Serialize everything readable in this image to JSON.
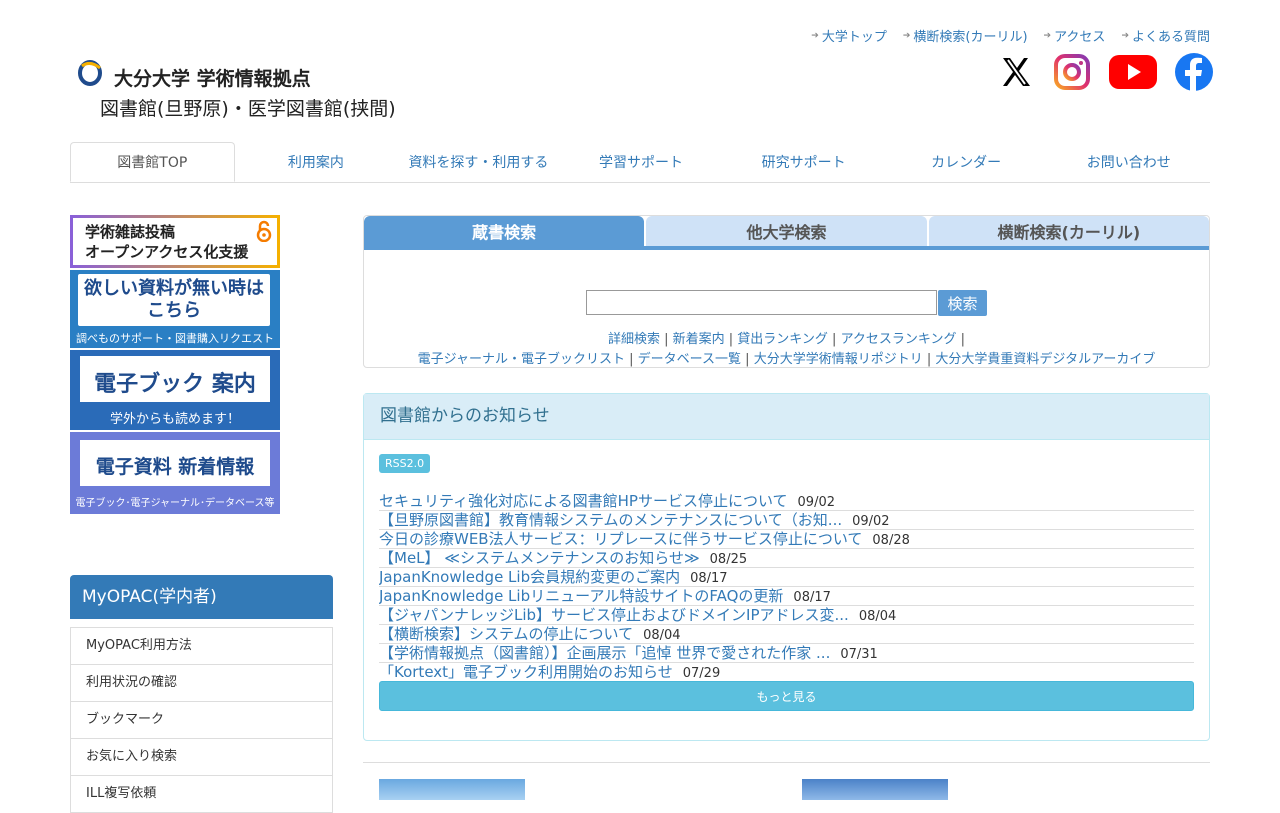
{
  "header": {
    "toplinks": [
      "大学トップ",
      "横断検索(カーリル)",
      "アクセス",
      "よくある質問"
    ],
    "logo_line1": "大分大学 学術情報拠点",
    "logo_line2": "図書館(旦野原)・医学図書館(挟間)",
    "social": [
      "x-icon",
      "instagram-icon",
      "youtube-icon",
      "facebook-icon"
    ]
  },
  "nav": {
    "tabs": [
      "図書館TOP",
      "利用案内",
      "資料を探す・利用する",
      "学習サポート",
      "研究サポート",
      "カレンダー",
      "お問い合わせ"
    ]
  },
  "banners": {
    "oa_line1": "学術雑誌投稿",
    "oa_line2": "オープンアクセス化支援",
    "request_line1": "欲しい資料が無い時は",
    "request_line2": "こちら",
    "request_sub": "調べものサポート・図書購入リクエスト",
    "ebook_title": "電子ブック 案内",
    "ebook_sub": "学外からも読めます！",
    "eres_title": "電子資料 新着情報",
    "eres_sub": "電子ブック･電子ジャーナル･データベース等"
  },
  "myopac": {
    "title": "MyOPAC(学内者)",
    "items": [
      "MyOPAC利用方法",
      "利用状況の確認",
      "ブックマーク",
      "お気に入り検索",
      "ILL複写依頼"
    ]
  },
  "search": {
    "tabs": [
      "蔵書検索",
      "他大学検索",
      "横断検索(カーリル)"
    ],
    "button": "検索",
    "input_value": "",
    "links_row1": [
      "詳細検索",
      "新着案内",
      "貸出ランキング",
      "アクセスランキング"
    ],
    "links_row2": [
      "電子ジャーナル・電子ブックリスト",
      "データベース一覧",
      "大分大学学術情報リポジトリ",
      "大分大学貴重資料デジタルアーカイブ"
    ]
  },
  "news": {
    "title": "図書館からのお知らせ",
    "rss": "RSS2.0",
    "items": [
      {
        "title": "セキュリティ強化対応による図書館HPサービス停止について",
        "date": "09/02"
      },
      {
        "title": "【旦野原図書館】教育情報システムのメンテナンスについて（お知...",
        "date": "09/02"
      },
      {
        "title": "今日の診療WEB法人サービス：リプレースに伴うサービス停止について",
        "date": "08/28"
      },
      {
        "title": "【MeL】 ≪システムメンテナンスのお知らせ≫",
        "date": "08/25"
      },
      {
        "title": "JapanKnowledge Lib会員規約変更のご案内",
        "date": "08/17"
      },
      {
        "title": "JapanKnowledge Libリニューアル特設サイトのFAQの更新",
        "date": "08/17"
      },
      {
        "title": "【ジャパンナレッジLib】サービス停止およびドメインIPアドレス変...",
        "date": "08/04"
      },
      {
        "title": "【横断検索】システムの停止について",
        "date": "08/04"
      },
      {
        "title": "【学術情報拠点（図書館）】企画展示「追悼 世界で愛された作家 ...",
        "date": "07/31"
      },
      {
        "title": "「Kortext」電子ブック利用開始のお知らせ",
        "date": "07/29"
      }
    ],
    "more": "もっと見る"
  }
}
